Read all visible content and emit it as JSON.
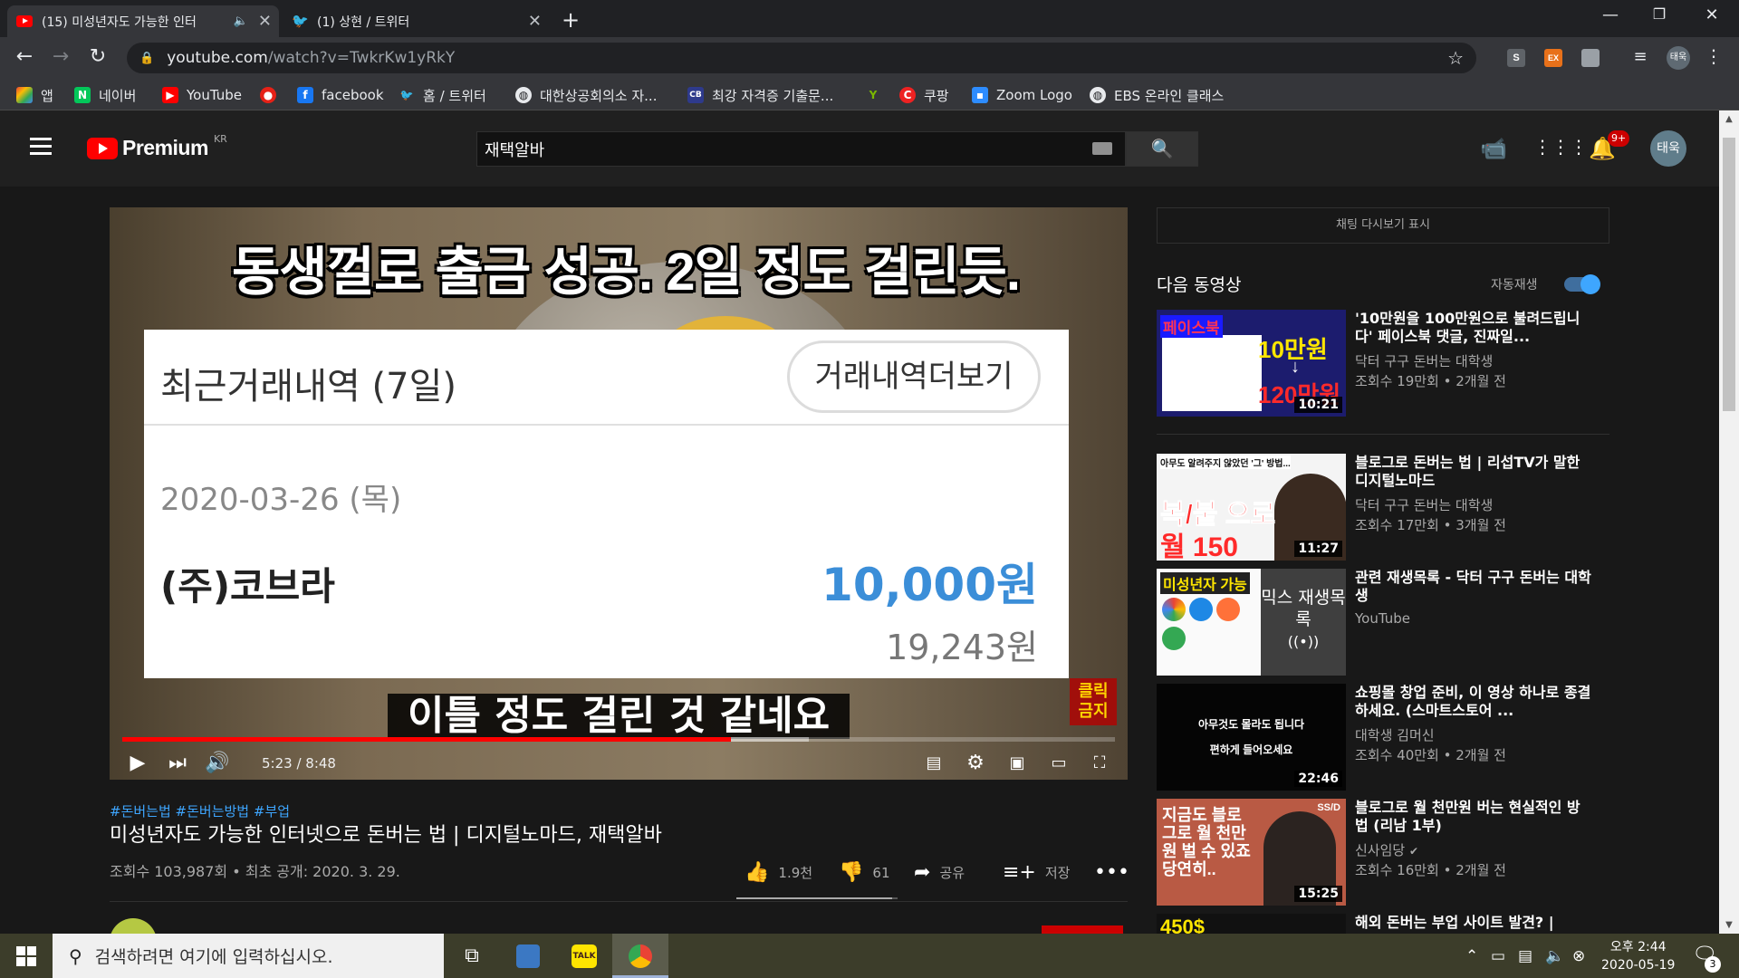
{
  "browser": {
    "tabs": [
      {
        "title": "(15) 미성년자도 가능한 인터",
        "active": true,
        "audio_icon": "speaker-icon"
      },
      {
        "title": "(1) 상현 / 트위터",
        "active": false
      }
    ],
    "url_host": "youtube.com",
    "url_path": "/watch?v=TwkrKw1yRkY",
    "profile_label": "태욱",
    "extensions": [
      "S",
      "EX"
    ],
    "bookmarks": [
      {
        "label": "앱",
        "icon": "apps-grid-icon"
      },
      {
        "label": "네이버",
        "icon": "naver-icon"
      },
      {
        "label": "YouTube",
        "icon": "youtube-icon"
      },
      {
        "label": "",
        "icon": "record-icon"
      },
      {
        "label": "facebook",
        "icon": "facebook-icon"
      },
      {
        "label": "홈 / 트위터",
        "icon": "twitter-icon"
      },
      {
        "label": "대한상공회의소 자...",
        "icon": "globe-icon"
      },
      {
        "label": "최강 자격증 기출문...",
        "icon": "cbt-icon"
      },
      {
        "label": "",
        "icon": "y-icon"
      },
      {
        "label": "쿠팡",
        "icon": "coupang-icon"
      },
      {
        "label": "Zoom Logo",
        "icon": "zoom-icon"
      },
      {
        "label": "EBS 온라인 클래스",
        "icon": "globe-icon"
      }
    ]
  },
  "youtube": {
    "logo_word": "Premium",
    "logo_region": "KR",
    "search_query": "재택알바",
    "notification_badge": "9+",
    "avatar_label": "태욱"
  },
  "video": {
    "frame": {
      "headline": "동생껄로 출금 성공. 2일 정도 걸린듯.",
      "panel_title": "최근거래내역 (7일)",
      "panel_button": "거래내역더보기",
      "date": "2020-03-26 (목)",
      "name": "(주)코브라",
      "amount": "10,000원",
      "balance": "19,243원",
      "subtitle": "이틀 정도 걸린 것 같네요",
      "badge": "클릭\n금지"
    },
    "current_time": "5:23",
    "duration": "8:48",
    "time_display": "5:23 / 8:48",
    "played_fraction": 0.613,
    "buffered_fraction": 0.692,
    "hashtags": "#돈버는법 #돈버는방법 #부업",
    "title": "미성년자도 가능한 인터넷으로 돈버는 법 | 디지털노마드, 재택알바",
    "views_line": "조회수 103,987회 • 최초 공개: 2020. 3. 29.",
    "likes": "1.9천",
    "dislikes": "61",
    "like_fraction": 0.969,
    "share_label": "공유",
    "save_label": "저장"
  },
  "sidebar": {
    "chat_replay": "채팅 다시보기 표시",
    "up_next": "다음 동영상",
    "autoplay_label": "자동재생",
    "autoplay_on": true,
    "recommendations": [
      {
        "title": "'10만원을 100만원으로 불려드립니다' 페이스북 댓글, 진짜일...",
        "channel": "닥터 구구 돈버는 대학생",
        "meta": "조회수 19만회 • 2개월 전",
        "duration": "10:21"
      },
      {
        "title": "블로그로 돈버는 법 | 리섭TV가 말한 디지털노마드",
        "channel": "닥터 구구 돈버는 대학생",
        "meta": "조회수 17만회 • 3개월 전",
        "duration": "11:27"
      },
      {
        "title": "관련 재생목록 - 닥터 구구 돈버는 대학생",
        "channel": "YouTube",
        "meta": "",
        "duration": "",
        "overlay": "믹스 재생목록"
      },
      {
        "title": "쇼핑몰 창업 준비, 이 영상 하나로 종결하세요. (스마트스토어 ...",
        "channel": "대학생 김머신",
        "meta": "조회수 40만회 • 2개월 전",
        "duration": "22:46"
      },
      {
        "title": "블로그로 월 천만원 버는 현실적인 방법 (리남 1부)",
        "channel": "신사임당",
        "meta": "조회수 16만회 • 2개월 전",
        "duration": "15:25",
        "verified": true
      },
      {
        "title": "해외 돈버는 부업 사이트 발견? |",
        "channel": "",
        "meta": "",
        "duration": ""
      }
    ],
    "thumb_texts": {
      "t1_left": "페이스북",
      "t1_big": "10만원",
      "t1_arrow": "↓",
      "t1_big2": "120만원",
      "t2_top": "아무도 알려주지 않았던 '그' 방법...",
      "t2_big": "복/붙 으로",
      "t2_big2": "월 150",
      "t3_top": "미성년자 가능",
      "t4_line1": "아무것도 몰라도 됩니다",
      "t4_line2": "편하게 들어오세요",
      "t5_text": "지금도 블로그로 월 천만원 벌 수 있죠 당연히..",
      "t5_corner": "SS/D",
      "t6_text": "450$"
    }
  },
  "taskbar": {
    "search_placeholder": "검색하려면 여기에 입력하십시오.",
    "time": "오후 2:44",
    "date": "2020-05-19",
    "notification_count": "3"
  },
  "colors": {
    "accent_red": "#ff0000",
    "link_blue": "#3ea6ff",
    "amount_blue": "#3b8ed8"
  }
}
